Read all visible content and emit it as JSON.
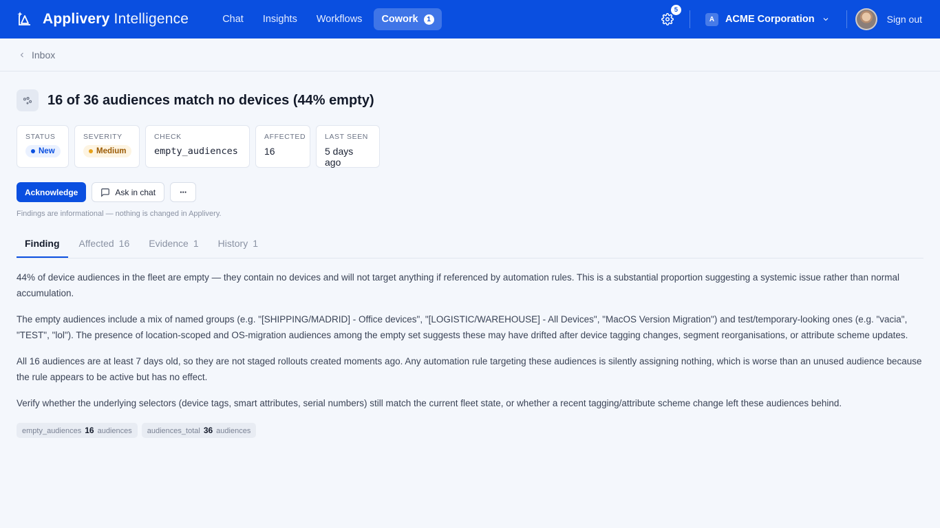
{
  "brand": {
    "name_bold": "Applivery",
    "name_light": "Intelligence"
  },
  "nav": [
    {
      "label": "Chat",
      "active": false
    },
    {
      "label": "Insights",
      "active": false
    },
    {
      "label": "Workflows",
      "active": false
    },
    {
      "label": "Cowork",
      "active": true,
      "badge": "1"
    }
  ],
  "header": {
    "settings_badge": "5",
    "org_initial": "A",
    "org_name": "ACME Corporation",
    "signout": "Sign out"
  },
  "breadcrumb": {
    "label": "Inbox"
  },
  "finding": {
    "title": "16 of 36 audiences match no devices (44% empty)",
    "cards": {
      "status_label": "STATUS",
      "status_value": "New",
      "severity_label": "SEVERITY",
      "severity_value": "Medium",
      "check_label": "CHECK",
      "check_value": "empty_audiences",
      "affected_label": "AFFECTED",
      "affected_value": "16",
      "lastseen_label": "LAST SEEN",
      "lastseen_value": "5 days ago"
    },
    "actions": {
      "acknowledge": "Acknowledge",
      "ask": "Ask in chat",
      "more": "···"
    },
    "note": "Findings are informational — nothing is changed in Applivery."
  },
  "tabs": [
    {
      "label": "Finding",
      "count": ""
    },
    {
      "label": "Affected",
      "count": "16"
    },
    {
      "label": "Evidence",
      "count": "1"
    },
    {
      "label": "History",
      "count": "1"
    }
  ],
  "body": {
    "p1": "44% of device audiences in the fleet are empty — they contain no devices and will not target anything if referenced by automation rules. This is a substantial proportion suggesting a systemic issue rather than normal accumulation.",
    "p2": "The empty audiences include a mix of named groups (e.g. \"[SHIPPING/MADRID] - Office devices\", \"[LOGISTIC/WAREHOUSE] - All Devices\", \"MacOS Version Migration\") and test/temporary-looking ones (e.g. \"vacia\", \"TEST\", \"lol\"). The presence of location-scoped and OS-migration audiences among the empty set suggests these may have drifted after device tagging changes, segment reorganisations, or attribute scheme updates.",
    "p3": "All 16 audiences are at least 7 days old, so they are not staged rollouts created moments ago. Any automation rule targeting these audiences is silently assigning nothing, which is worse than an unused audience because the rule appears to be active but has no effect.",
    "p4": "Verify whether the underlying selectors (device tags, smart attributes, serial numbers) still match the current fleet state, or whether a recent tagging/attribute scheme change left these audiences behind."
  },
  "metrics": [
    {
      "key": "empty_audiences",
      "value": "16",
      "unit": "audiences"
    },
    {
      "key": "audiences_total",
      "value": "36",
      "unit": "audiences"
    }
  ],
  "colors": {
    "brand": "#0a4fe0",
    "status_new": "#0a4fe0",
    "severity_medium": "#e7a21a"
  }
}
